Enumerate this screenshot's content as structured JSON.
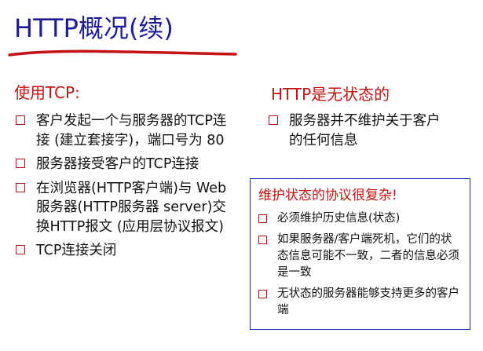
{
  "title": "HTTP概况(续)",
  "left": {
    "heading": "使用TCP:",
    "items": [
      {
        "text": "客户发起一个与服务器的TCP连接 (建立套接字)，端口号为 80"
      },
      {
        "text": "服务器接受客户的TCP连接"
      },
      {
        "text": "在浏览器(HTTP客户端)与 Web服务器(HTTP服务器 server)交换HTTP报文 (应用层协议报文)"
      },
      {
        "text": "TCP连接关闭"
      }
    ]
  },
  "right": {
    "heading": "HTTP是无状态的",
    "items": [
      {
        "text": "服务器并不维护关于客户的任何信息"
      }
    ],
    "box": {
      "heading": "维护状态的协议很复杂!",
      "items": [
        {
          "text": "必须维护历史信息(状态)"
        },
        {
          "text": "如果服务器/客户端死机，它们的状态信息可能不一致，二者的信息必须是一致"
        },
        {
          "text": "无状态的服务器能够支持更多的客户端"
        }
      ]
    }
  },
  "colors": {
    "title": "#1c1c99",
    "heading": "#c41212",
    "underline": "#c41212",
    "box_border": "#1d2aa1",
    "bullet": "#b31616"
  },
  "icons": {
    "bullet": "checkbox-icon"
  }
}
